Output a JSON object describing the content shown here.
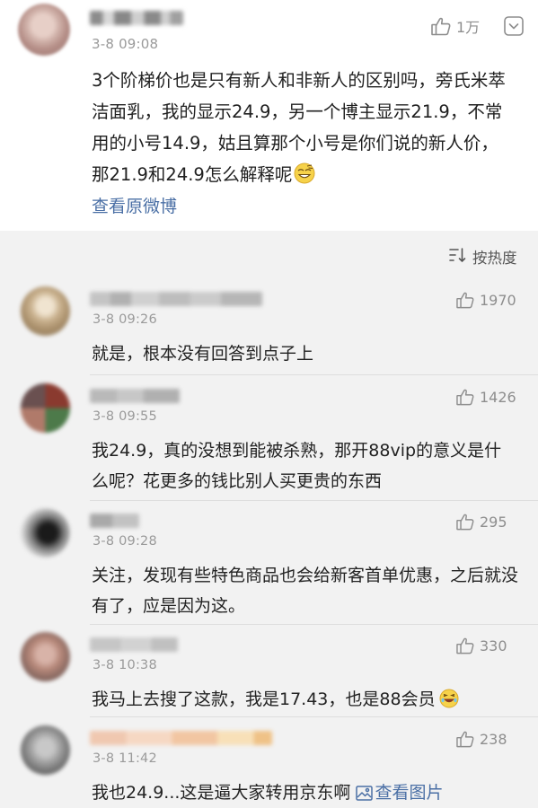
{
  "main_post": {
    "timestamp": "3-8 09:08",
    "like_count": "1万",
    "text": "3个阶梯价也是只有新人和非新人的区别吗，旁氏米萃洁面乳，我的显示24.9，另一个博主显示21.9，不常用的小号14.9，姑且算那个小号是你们说的新人价，那21.9和24.9怎么解释呢",
    "view_original_label": "查看原微博"
  },
  "sort": {
    "label": "按热度"
  },
  "comments": [
    {
      "timestamp": "3-8 09:26",
      "likes": "1970",
      "text": "就是，根本没有回答到点子上"
    },
    {
      "timestamp": "3-8 09:55",
      "likes": "1426",
      "text": "我24.9，真的没想到能被杀熟，那开88vip的意义是什么呢？花更多的钱比别人买更贵的东西"
    },
    {
      "timestamp": "3-8 09:28",
      "likes": "295",
      "text": "关注，发现有些特色商品也会给新客首单优惠，之后就没有了，应是因为这。"
    },
    {
      "timestamp": "3-8 10:38",
      "likes": "330",
      "text": "我马上去搜了这款，我是17.43，也是88会员"
    },
    {
      "timestamp": "3-8 11:42",
      "likes": "238",
      "text": "我也24.9...这是逼大家转用京东啊",
      "link": "查看图片"
    }
  ],
  "icons": {
    "like": "thumbs-up-icon",
    "more": "chevron-down-icon",
    "sort": "sort-lines-icon",
    "image": "image-icon"
  },
  "colors": {
    "link": "#4a6fa5",
    "meta": "#9a9a9a",
    "comments_bg": "#f2f2f2"
  }
}
